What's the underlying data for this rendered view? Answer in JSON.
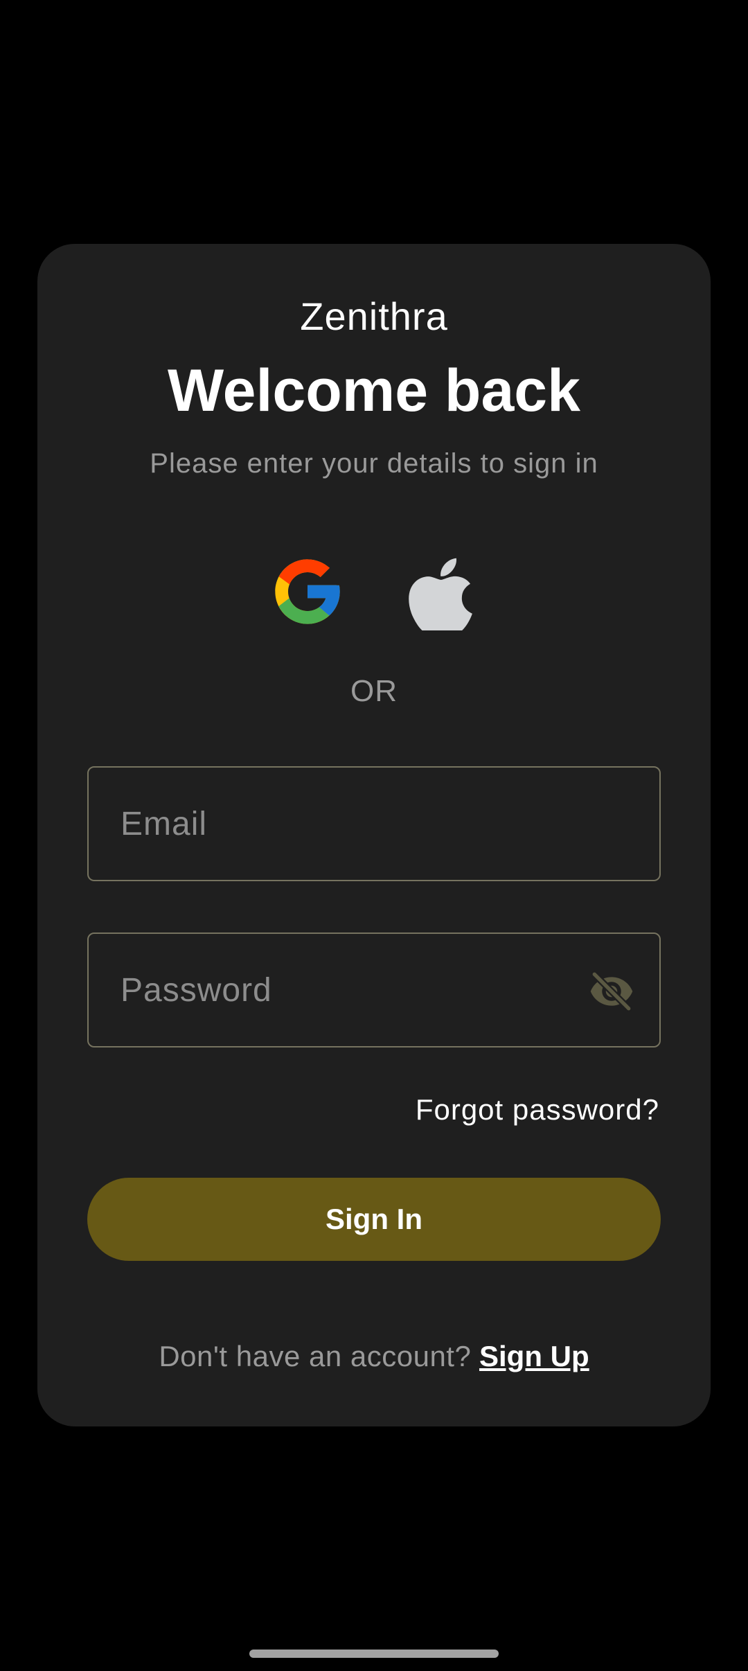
{
  "app": {
    "brand": "Zenithra"
  },
  "header": {
    "title": "Welcome back",
    "subtitle": "Please enter your details to sign in"
  },
  "social": {
    "google_icon": "google-logo-icon",
    "apple_icon": "apple-logo-icon",
    "divider_text": "OR"
  },
  "form": {
    "email": {
      "value": "",
      "placeholder": "Email"
    },
    "password": {
      "value": "",
      "placeholder": "Password",
      "toggle_icon": "eye-off-icon"
    },
    "forgot_label": "Forgot password?",
    "submit_label": "Sign In"
  },
  "footer": {
    "prompt": "Don't have an account?",
    "link_label": "Sign Up"
  },
  "colors": {
    "background": "#000000",
    "card": "#1f1f1f",
    "accent": "#675915",
    "field_border": "#76735f",
    "muted_text": "#9a9a9a"
  }
}
